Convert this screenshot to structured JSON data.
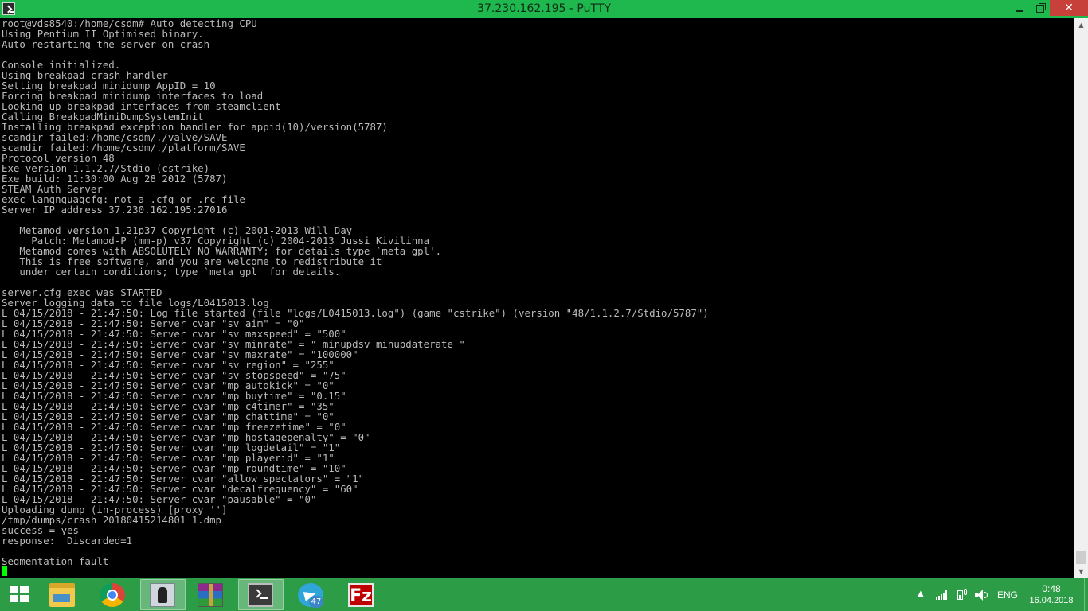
{
  "window": {
    "title": "37.230.162.195 - PuTTY",
    "close_glyph": "✕"
  },
  "terminal": {
    "lines": [
      "root@vds8540:/home/csdm# Auto detecting CPU",
      "Using Pentium II Optimised binary.",
      "Auto-restarting the server on crash",
      "",
      "Console initialized.",
      "Using breakpad crash handler",
      "Setting breakpad minidump AppID = 10",
      "Forcing breakpad minidump interfaces to load",
      "Looking up breakpad interfaces from steamclient",
      "Calling BreakpadMiniDumpSystemInit",
      "Installing breakpad exception handler for appid(10)/version(5787)",
      "scandir failed:/home/csdm/./valve/SAVE",
      "scandir failed:/home/csdm/./platform/SAVE",
      "Protocol version 48",
      "Exe version 1.1.2.7/Stdio (cstrike)",
      "Exe build: 11:30:00 Aug 28 2012 (5787)",
      "STEAM Auth Server",
      "exec langnguagcfg: not a .cfg or .rc file",
      "Server IP address 37.230.162.195:27016",
      "",
      "   Metamod version 1.21p37 Copyright (c) 2001-2013 Will Day",
      "     Patch: Metamod-P (mm-p) v37 Copyright (c) 2004-2013 Jussi Kivilinna",
      "   Metamod comes with ABSOLUTELY NO WARRANTY; for details type `meta gpl'.",
      "   This is free software, and you are welcome to redistribute it",
      "   under certain conditions; type `meta gpl' for details.",
      "",
      "server.cfg exec was STARTED",
      "Server logging data to file logs/L0415013.log",
      "L 04/15/2018 - 21:47:50: Log file started (file \"logs/L0415013.log\") (game \"cstrike\") (version \"48/1.1.2.7/Stdio/5787\")",
      "L 04/15/2018 - 21:47:50: Server cvar \"sv_aim\" = \"0\"",
      "L 04/15/2018 - 21:47:50: Server cvar \"sv_maxspeed\" = \"500\"",
      "L 04/15/2018 - 21:47:50: Server cvar \"sv_minrate\" = \"_minupdsv_minupdaterate \"",
      "L 04/15/2018 - 21:47:50: Server cvar \"sv_maxrate\" = \"100000\"",
      "L 04/15/2018 - 21:47:50: Server cvar \"sv_region\" = \"255\"",
      "L 04/15/2018 - 21:47:50: Server cvar \"sv_stopspeed\" = \"75\"",
      "L 04/15/2018 - 21:47:50: Server cvar \"mp_autokick\" = \"0\"",
      "L 04/15/2018 - 21:47:50: Server cvar \"mp_buytime\" = \"0.15\"",
      "L 04/15/2018 - 21:47:50: Server cvar \"mp_c4timer\" = \"35\"",
      "L 04/15/2018 - 21:47:50: Server cvar \"mp_chattime\" = \"0\"",
      "L 04/15/2018 - 21:47:50: Server cvar \"mp_freezetime\" = \"0\"",
      "L 04/15/2018 - 21:47:50: Server cvar \"mp_hostagepenalty\" = \"0\"",
      "L 04/15/2018 - 21:47:50: Server cvar \"mp_logdetail\" = \"1\"",
      "L 04/15/2018 - 21:47:50: Server cvar \"mp_playerid\" = \"1\"",
      "L 04/15/2018 - 21:47:50: Server cvar \"mp_roundtime\" = \"10\"",
      "L 04/15/2018 - 21:47:50: Server cvar \"allow_spectators\" = \"1\"",
      "L 04/15/2018 - 21:47:50: Server cvar \"decalfrequency\" = \"60\"",
      "L 04/15/2018 - 21:47:50: Server cvar \"pausable\" = \"0\"",
      "Uploading dump (in-process) [proxy '']",
      "/tmp/dumps/crash_20180415214801_1.dmp",
      "success = yes",
      "response:  Discarded=1",
      "",
      "Segmentation fault"
    ]
  },
  "taskbar": {
    "apps": [
      {
        "name": "file-explorer",
        "icon": "folder-icon"
      },
      {
        "name": "google-chrome",
        "icon": "chrome-icon"
      },
      {
        "name": "counter-strike",
        "icon": "counter-strike-icon",
        "active": true
      },
      {
        "name": "winrar",
        "icon": "winrar-icon"
      },
      {
        "name": "putty",
        "icon": "putty-icon"
      },
      {
        "name": "telegram",
        "icon": "telegram-icon",
        "badge": "47"
      },
      {
        "name": "filezilla",
        "icon": "filezilla-icon",
        "glyph": "Fz"
      }
    ],
    "tray": {
      "lang": "ENG",
      "time": "0:48",
      "date": "16.04.2018",
      "overflow_glyph": "▲"
    }
  },
  "colors": {
    "titlebar": "#1fb84e",
    "taskbar": "#2d9c47",
    "close": "#c7403a",
    "terminal_text": "#bbbbbb",
    "cursor": "#00ff00"
  }
}
